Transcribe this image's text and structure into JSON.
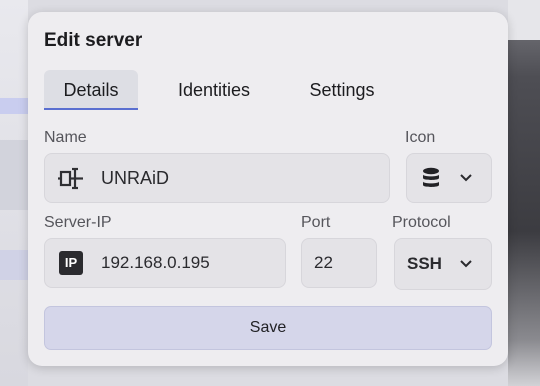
{
  "dialog": {
    "title": "Edit server",
    "tabs": [
      {
        "label": "Details",
        "active": true
      },
      {
        "label": "Identities",
        "active": false
      },
      {
        "label": "Settings",
        "active": false
      }
    ],
    "name": {
      "label": "Name",
      "value": "UNRAiD",
      "icon": "server-rack-icon"
    },
    "icon_field": {
      "label": "Icon",
      "selected_icon": "database-icon"
    },
    "server_ip": {
      "label": "Server-IP",
      "value": "192.168.0.195",
      "badge": "IP"
    },
    "port": {
      "label": "Port",
      "value": "22"
    },
    "protocol": {
      "label": "Protocol",
      "value": "SSH"
    },
    "save_label": "Save"
  },
  "colors": {
    "accent": "#5a6fd0",
    "save_bg": "#d5d6ea"
  }
}
